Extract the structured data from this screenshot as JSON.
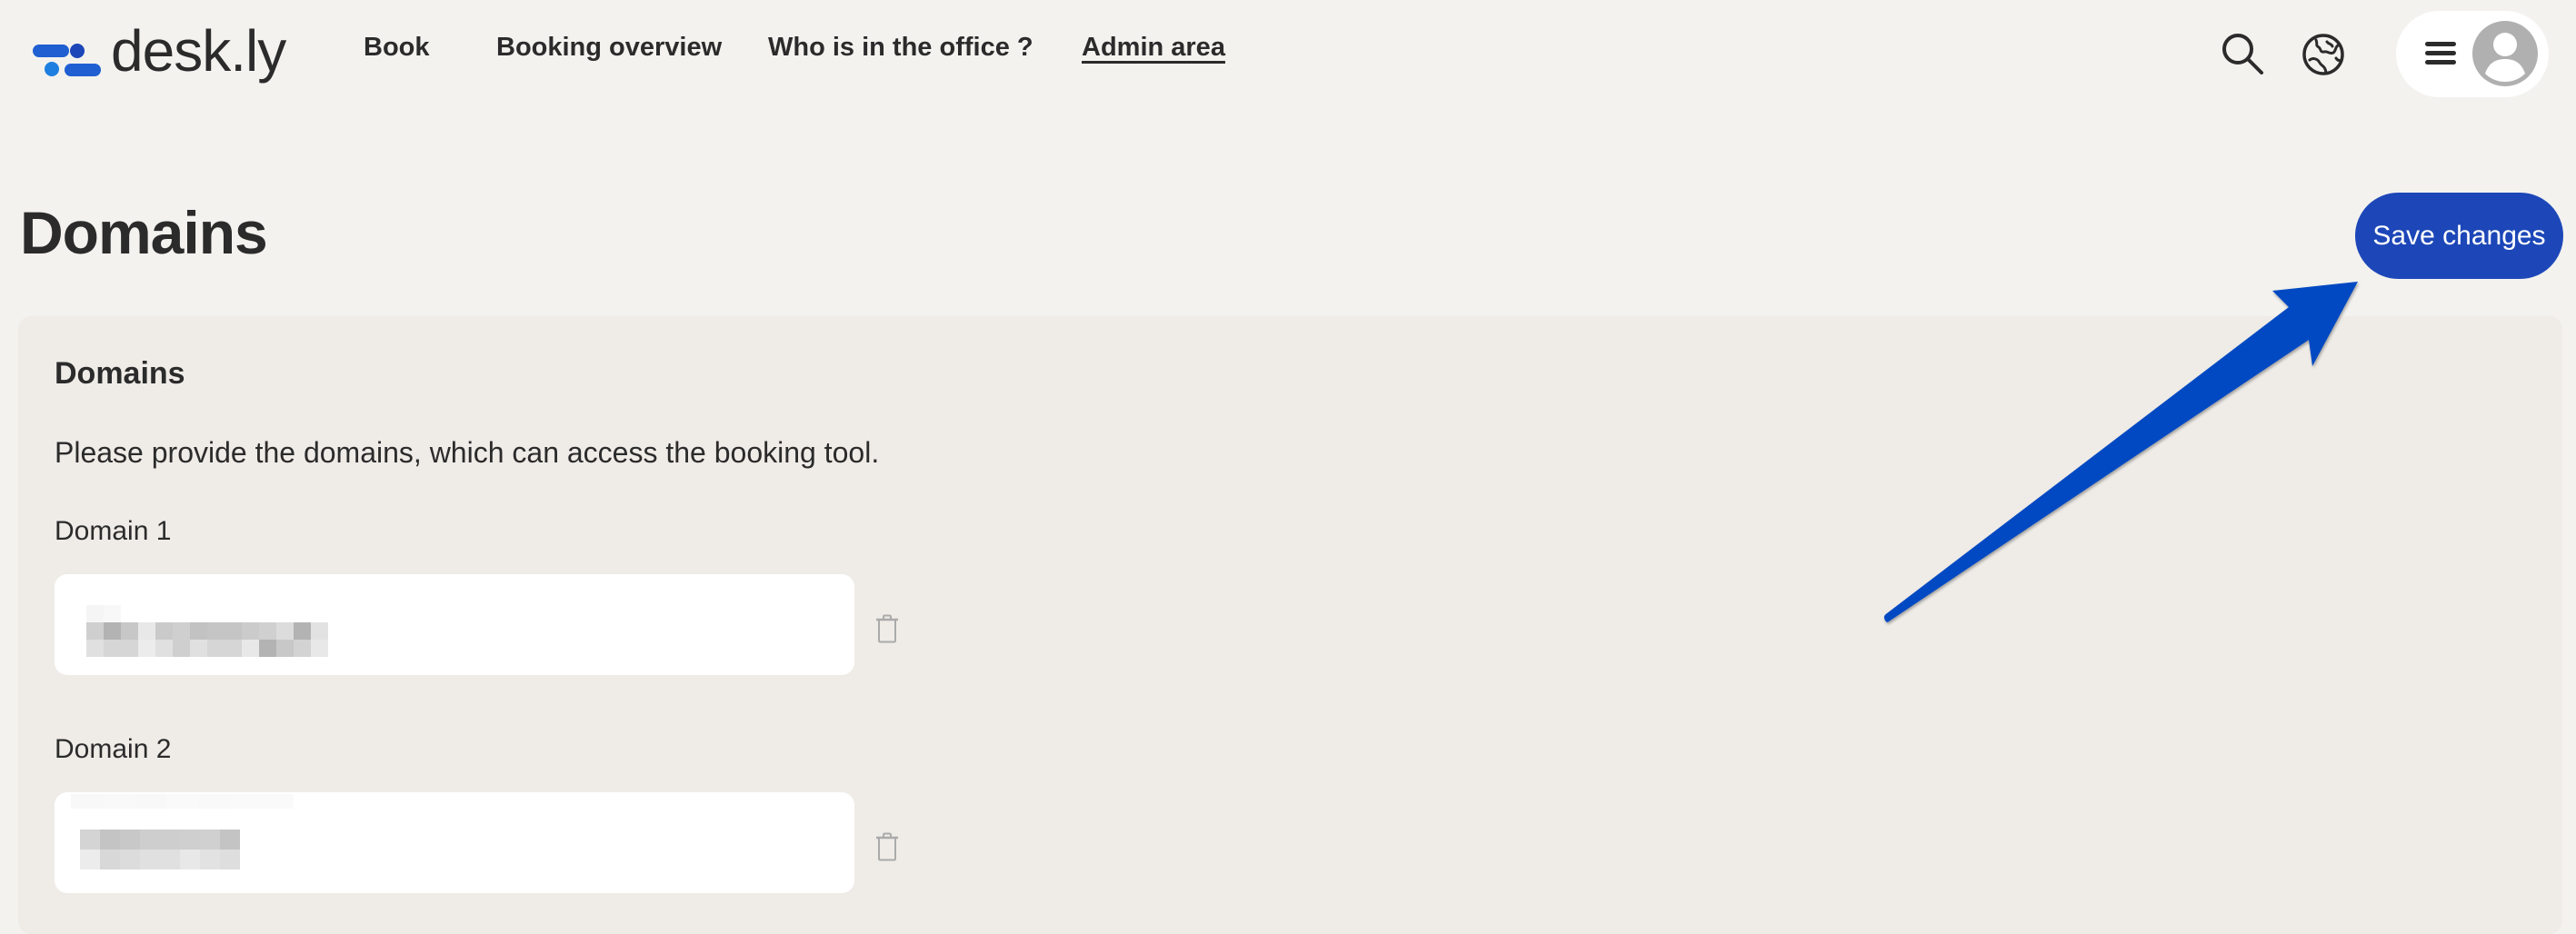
{
  "header": {
    "logo_text": "desk.ly",
    "nav": [
      {
        "label": "Book",
        "active": false
      },
      {
        "label": "Booking overview",
        "active": false
      },
      {
        "label": "Who is in the office ?",
        "active": false
      },
      {
        "label": "Admin area",
        "active": true
      }
    ],
    "icons": [
      "search-icon",
      "globe-icon",
      "hamburger-menu-icon",
      "user-avatar-icon"
    ]
  },
  "page": {
    "title": "Domains",
    "save_label": "Save changes"
  },
  "card": {
    "title": "Domains",
    "description": "Please provide the domains, which can access the booking tool.",
    "fields": [
      {
        "label": "Domain 1",
        "value": "[redacted]",
        "redacted": true,
        "delete_icon": "trash-icon"
      },
      {
        "label": "Domain 2",
        "value": "[redacted]",
        "redacted": true,
        "delete_icon": "trash-icon"
      }
    ]
  },
  "annotation": {
    "type": "arrow",
    "points_to": "save-changes-button"
  },
  "colors": {
    "background": "#f3f2ef",
    "card": "#efece8",
    "accent": "#1d47b8",
    "arrow": "#0349c2",
    "text": "#2b2b2b",
    "icon_muted": "#aaaaaa",
    "avatar": "#b0b0b0"
  }
}
